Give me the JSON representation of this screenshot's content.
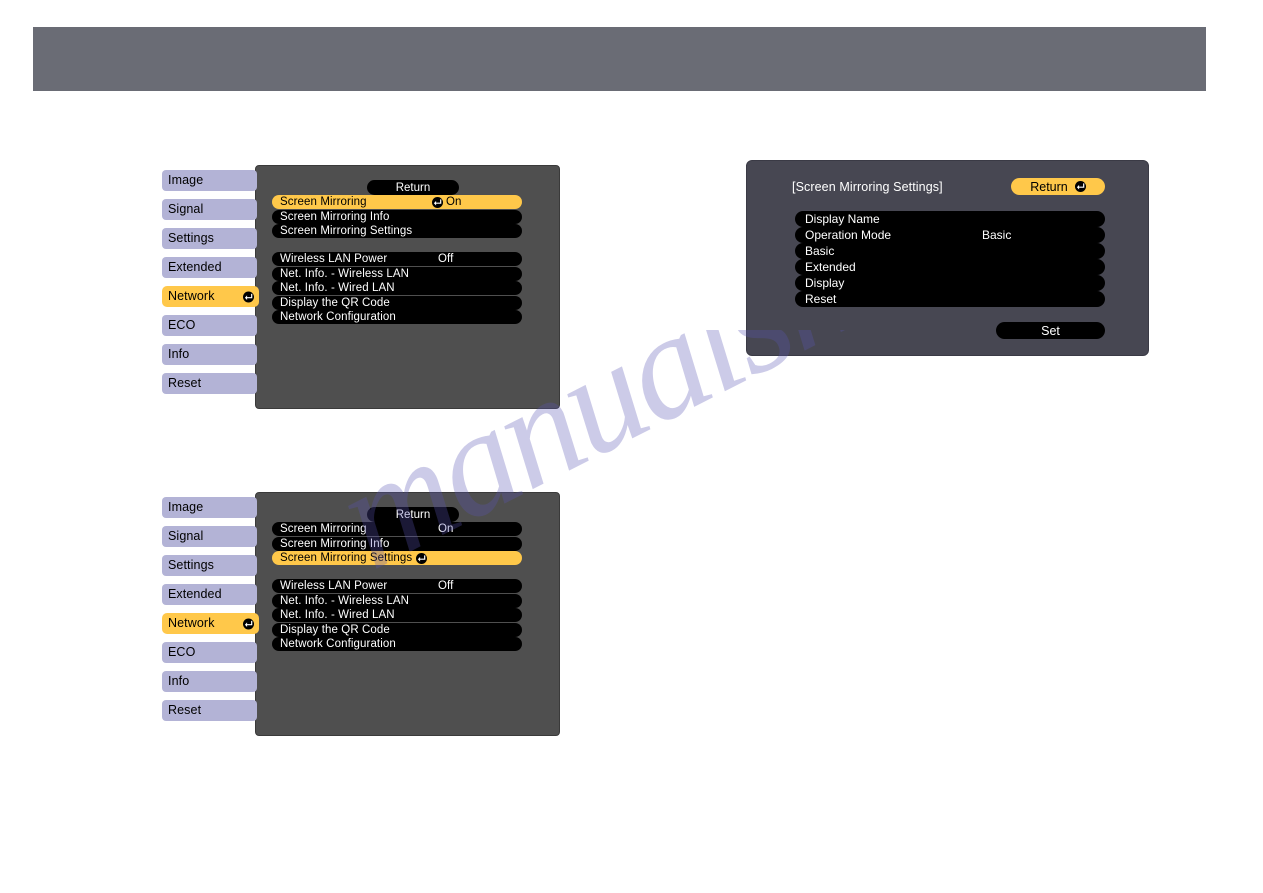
{
  "header": {
    "bar_label": ""
  },
  "watermark": {
    "text": "manualshive.com"
  },
  "icons": {
    "enter": "enter-key-icon"
  },
  "colors": {
    "highlight": "#ffc84a",
    "sidebar_item": "#b3b3d6",
    "panel_bg": "#4f4f4f",
    "dialog_bg": "#474752",
    "row_bg": "#000000",
    "header_bar": "#6a6c75"
  },
  "figure_top_left": {
    "sidebar": [
      {
        "label": "Image",
        "active": false
      },
      {
        "label": "Signal",
        "active": false
      },
      {
        "label": "Settings",
        "active": false
      },
      {
        "label": "Extended",
        "active": false
      },
      {
        "label": "Network",
        "active": true
      },
      {
        "label": "ECO",
        "active": false
      },
      {
        "label": "Info",
        "active": false
      },
      {
        "label": "Reset",
        "active": false
      }
    ],
    "return_label": "Return",
    "group_one": [
      {
        "label": "Screen Mirroring",
        "value": "On",
        "highlight": true,
        "enter": true
      },
      {
        "label": "Screen Mirroring Info",
        "value": "",
        "highlight": false,
        "enter": false
      },
      {
        "label": "Screen Mirroring Settings",
        "value": "",
        "highlight": false,
        "enter": false
      }
    ],
    "group_two": [
      {
        "label": "Wireless LAN Power",
        "value": "Off"
      },
      {
        "label": "Net. Info. - Wireless LAN",
        "value": ""
      },
      {
        "label": "Net. Info. - Wired LAN",
        "value": ""
      },
      {
        "label": "Display the QR Code",
        "value": ""
      },
      {
        "label": "Network Configuration",
        "value": ""
      }
    ]
  },
  "figure_bottom_left": {
    "sidebar": [
      {
        "label": "Image",
        "active": false
      },
      {
        "label": "Signal",
        "active": false
      },
      {
        "label": "Settings",
        "active": false
      },
      {
        "label": "Extended",
        "active": false
      },
      {
        "label": "Network",
        "active": true
      },
      {
        "label": "ECO",
        "active": false
      },
      {
        "label": "Info",
        "active": false
      },
      {
        "label": "Reset",
        "active": false
      }
    ],
    "return_label": "Return",
    "group_one": [
      {
        "label": "Screen Mirroring",
        "value": "On",
        "highlight": false,
        "enter": false
      },
      {
        "label": "Screen Mirroring Info",
        "value": "",
        "highlight": false,
        "enter": false
      },
      {
        "label": "Screen Mirroring Settings",
        "value": "",
        "highlight": true,
        "enter": true
      }
    ],
    "group_two": [
      {
        "label": "Wireless LAN Power",
        "value": "Off"
      },
      {
        "label": "Net. Info. - Wireless LAN",
        "value": ""
      },
      {
        "label": "Net. Info. - Wired LAN",
        "value": ""
      },
      {
        "label": "Display the QR Code",
        "value": ""
      },
      {
        "label": "Network Configuration",
        "value": ""
      }
    ]
  },
  "figure_right": {
    "title": "[Screen Mirroring Settings]",
    "return_label": "Return",
    "set_label": "Set",
    "rows": [
      {
        "label": "Display Name",
        "value": ""
      },
      {
        "label": "Operation Mode",
        "value": "Basic"
      },
      {
        "label": "Basic",
        "value": ""
      },
      {
        "label": "Extended",
        "value": ""
      },
      {
        "label": "Display",
        "value": ""
      },
      {
        "label": "Reset",
        "value": ""
      }
    ]
  }
}
